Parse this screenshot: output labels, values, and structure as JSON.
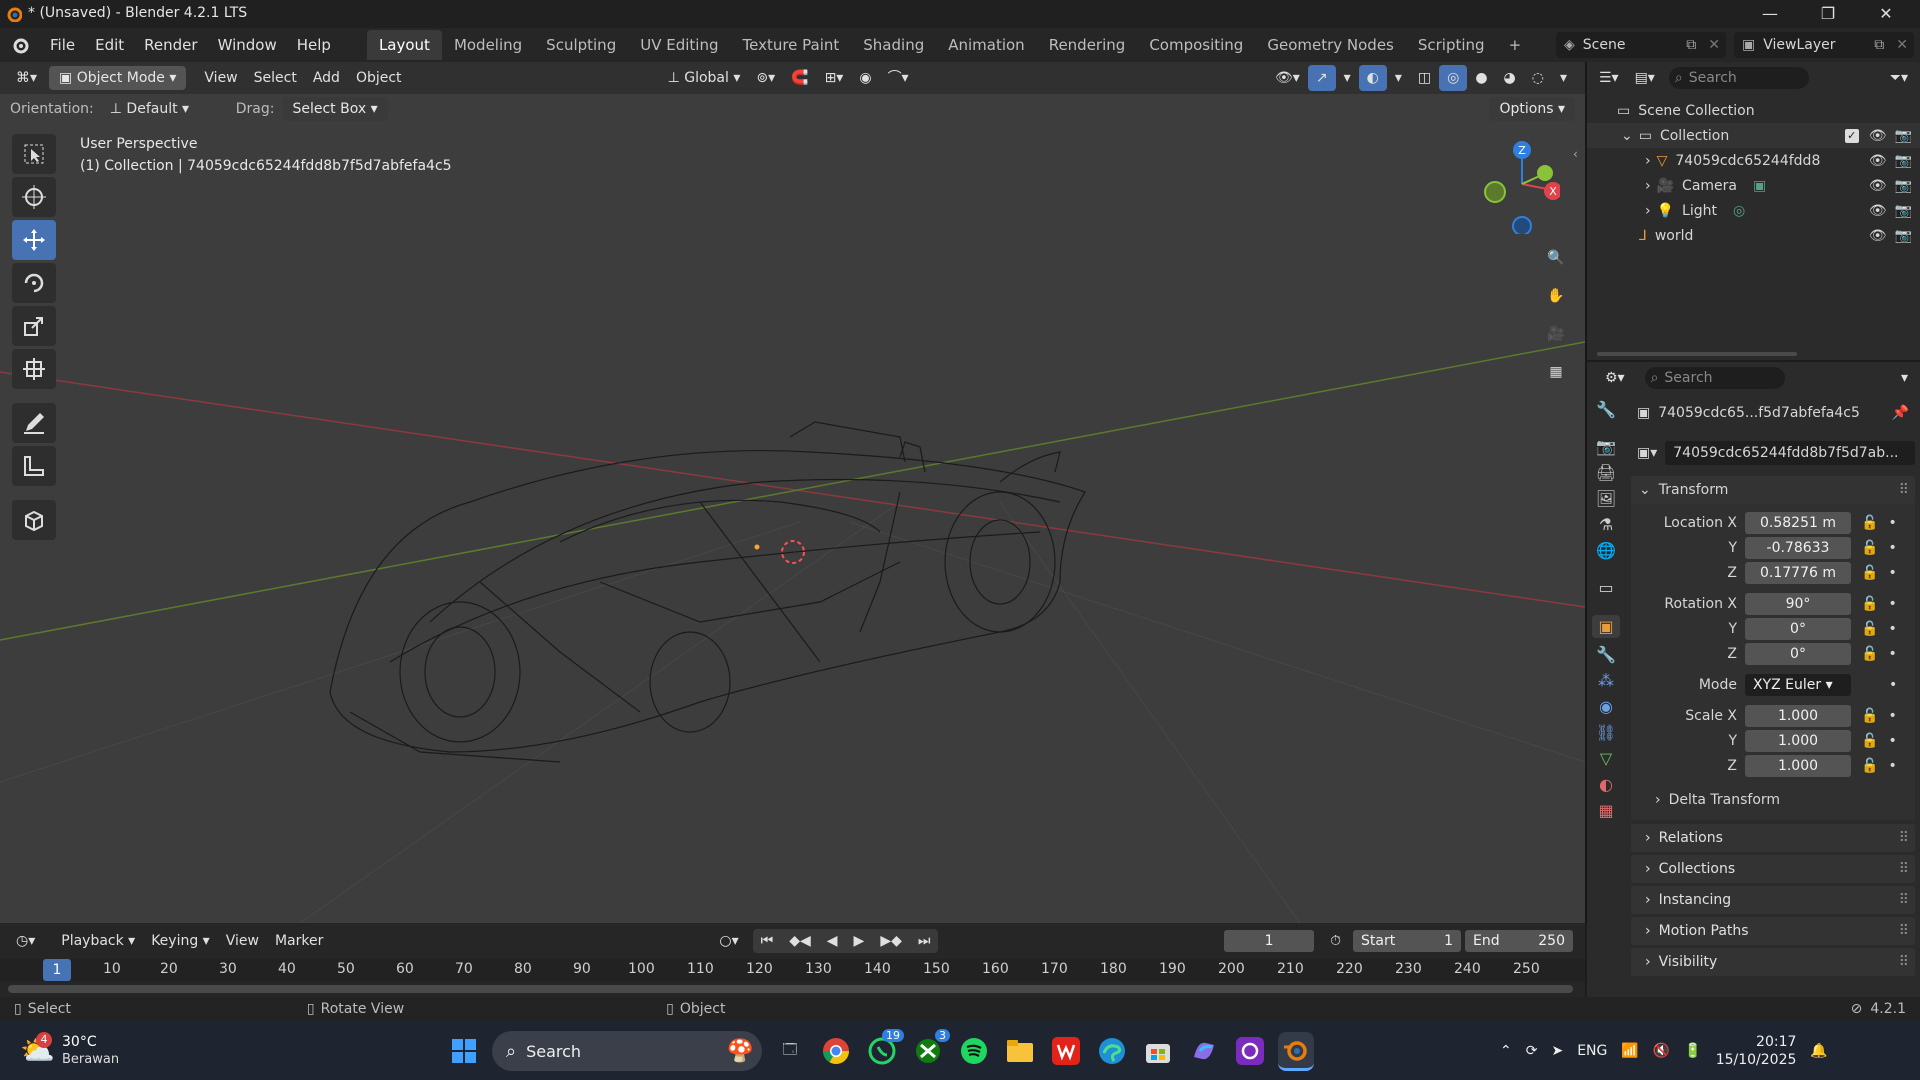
{
  "window": {
    "title": "* (Unsaved) - Blender 4.2.1 LTS"
  },
  "menu": [
    "File",
    "Edit",
    "Render",
    "Window",
    "Help"
  ],
  "workspaces": [
    "Layout",
    "Modeling",
    "Sculpting",
    "UV Editing",
    "Texture Paint",
    "Shading",
    "Animation",
    "Rendering",
    "Compositing",
    "Geometry Nodes",
    "Scripting"
  ],
  "scene": {
    "name": "Scene",
    "view_layer": "ViewLayer"
  },
  "viewport": {
    "mode": "Object Mode",
    "menu": [
      "View",
      "Select",
      "Add",
      "Object"
    ],
    "transform_orientation": "Global",
    "orientation_label": "Orientation:",
    "orientation_value": "Default",
    "drag_label": "Drag:",
    "drag_value": "Select Box",
    "options": "Options",
    "overlay_title": "User Perspective",
    "overlay_sub": "(1) Collection | 74059cdc65244fdd8b7f5d7abfefa4c5",
    "gizmo": {
      "z": "Z",
      "x": "X"
    }
  },
  "outliner": {
    "search_placeholder": "Search",
    "items": [
      {
        "label": "Scene Collection"
      },
      {
        "label": "Collection"
      },
      {
        "label": "74059cdc65244fdd8"
      },
      {
        "label": "Camera"
      },
      {
        "label": "Light"
      },
      {
        "label": "world"
      }
    ]
  },
  "properties": {
    "search_placeholder": "Search",
    "object_name_short": "74059cdc65...f5d7abfefa4c5",
    "object_name_full": "74059cdc65244fdd8b7f5d7ab...",
    "transform_header": "Transform",
    "location_label": "Location X",
    "location": {
      "x": "0.58251 m",
      "y": "-0.78633",
      "z": "0.17776 m"
    },
    "rotation_label": "Rotation X",
    "rotation": {
      "x": "90°",
      "y": "0°",
      "z": "0°"
    },
    "mode_label": "Mode",
    "mode_value": "XYZ Euler",
    "scale_label": "Scale X",
    "scale": {
      "x": "1.000",
      "y": "1.000",
      "z": "1.000"
    },
    "axis": {
      "y": "Y",
      "z": "Z"
    },
    "subpanels": [
      "Delta Transform",
      "Relations",
      "Collections",
      "Instancing",
      "Motion Paths",
      "Visibility"
    ]
  },
  "timeline": {
    "menus": [
      "Playback",
      "Keying",
      "View",
      "Marker"
    ],
    "current_frame": "1",
    "start_label": "Start",
    "start": "1",
    "end_label": "End",
    "end": "250",
    "ticks": [
      "1",
      "10",
      "20",
      "30",
      "40",
      "50",
      "60",
      "70",
      "80",
      "90",
      "100",
      "110",
      "120",
      "130",
      "140",
      "150",
      "160",
      "170",
      "180",
      "190",
      "200",
      "210",
      "220",
      "230",
      "240",
      "250"
    ]
  },
  "statusbar": {
    "left": "Select",
    "middle": "Rotate View",
    "right": "Object",
    "version": "4.2.1"
  },
  "taskbar": {
    "weather_temp": "30°C",
    "weather_desc": "Berawan",
    "weather_badge": "4",
    "search": "Search",
    "whatsapp_badge": "19",
    "xbox_badge": "3",
    "lang": "ENG",
    "time": "20:17",
    "date": "15/10/2025"
  },
  "colors": {
    "accent": "#4772b3",
    "x_axis": "#e0444a",
    "y_axis": "#8ac23a",
    "z_axis": "#2f7fe0"
  }
}
